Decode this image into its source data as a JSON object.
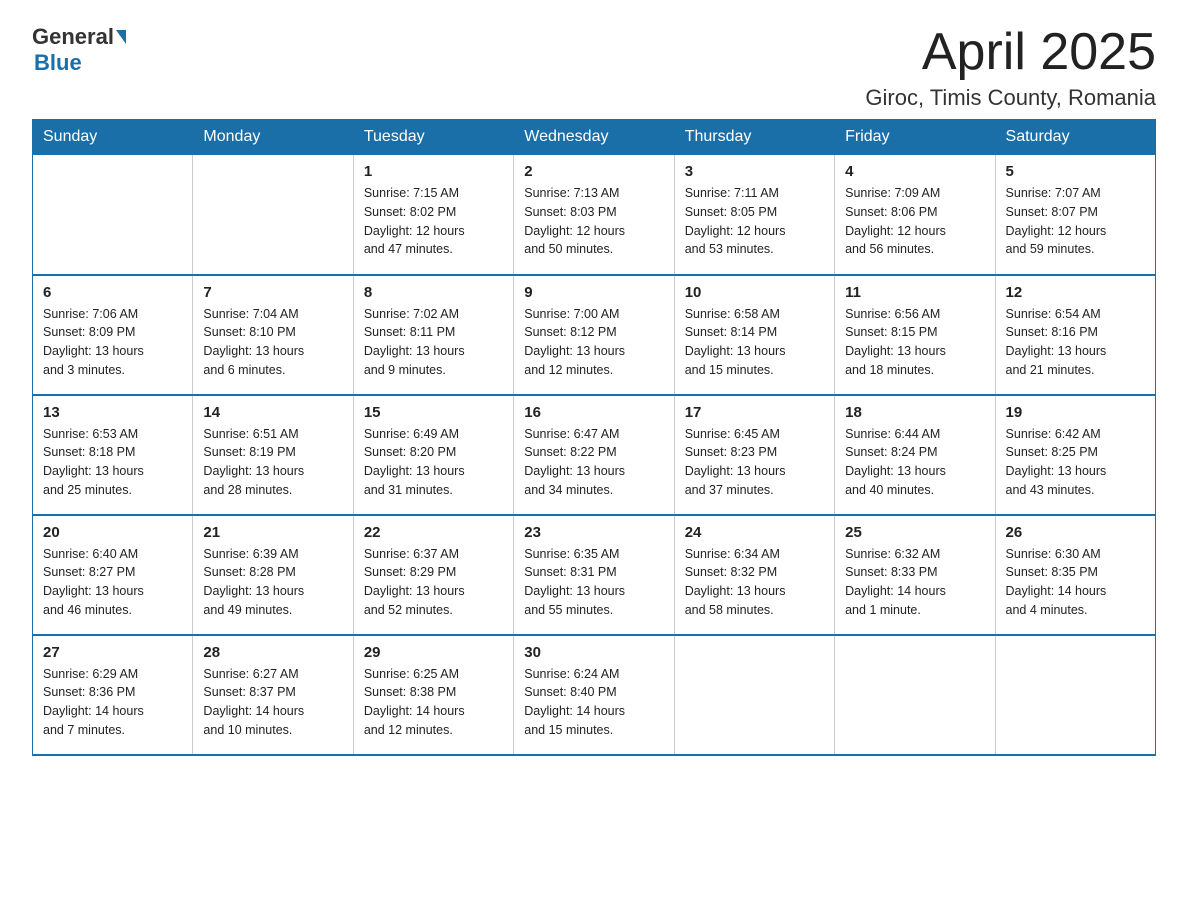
{
  "header": {
    "logo_general": "General",
    "logo_blue": "Blue",
    "month_title": "April 2025",
    "location": "Giroc, Timis County, Romania"
  },
  "columns": [
    "Sunday",
    "Monday",
    "Tuesday",
    "Wednesday",
    "Thursday",
    "Friday",
    "Saturday"
  ],
  "weeks": [
    [
      {
        "day": "",
        "info": ""
      },
      {
        "day": "",
        "info": ""
      },
      {
        "day": "1",
        "info": "Sunrise: 7:15 AM\nSunset: 8:02 PM\nDaylight: 12 hours\nand 47 minutes."
      },
      {
        "day": "2",
        "info": "Sunrise: 7:13 AM\nSunset: 8:03 PM\nDaylight: 12 hours\nand 50 minutes."
      },
      {
        "day": "3",
        "info": "Sunrise: 7:11 AM\nSunset: 8:05 PM\nDaylight: 12 hours\nand 53 minutes."
      },
      {
        "day": "4",
        "info": "Sunrise: 7:09 AM\nSunset: 8:06 PM\nDaylight: 12 hours\nand 56 minutes."
      },
      {
        "day": "5",
        "info": "Sunrise: 7:07 AM\nSunset: 8:07 PM\nDaylight: 12 hours\nand 59 minutes."
      }
    ],
    [
      {
        "day": "6",
        "info": "Sunrise: 7:06 AM\nSunset: 8:09 PM\nDaylight: 13 hours\nand 3 minutes."
      },
      {
        "day": "7",
        "info": "Sunrise: 7:04 AM\nSunset: 8:10 PM\nDaylight: 13 hours\nand 6 minutes."
      },
      {
        "day": "8",
        "info": "Sunrise: 7:02 AM\nSunset: 8:11 PM\nDaylight: 13 hours\nand 9 minutes."
      },
      {
        "day": "9",
        "info": "Sunrise: 7:00 AM\nSunset: 8:12 PM\nDaylight: 13 hours\nand 12 minutes."
      },
      {
        "day": "10",
        "info": "Sunrise: 6:58 AM\nSunset: 8:14 PM\nDaylight: 13 hours\nand 15 minutes."
      },
      {
        "day": "11",
        "info": "Sunrise: 6:56 AM\nSunset: 8:15 PM\nDaylight: 13 hours\nand 18 minutes."
      },
      {
        "day": "12",
        "info": "Sunrise: 6:54 AM\nSunset: 8:16 PM\nDaylight: 13 hours\nand 21 minutes."
      }
    ],
    [
      {
        "day": "13",
        "info": "Sunrise: 6:53 AM\nSunset: 8:18 PM\nDaylight: 13 hours\nand 25 minutes."
      },
      {
        "day": "14",
        "info": "Sunrise: 6:51 AM\nSunset: 8:19 PM\nDaylight: 13 hours\nand 28 minutes."
      },
      {
        "day": "15",
        "info": "Sunrise: 6:49 AM\nSunset: 8:20 PM\nDaylight: 13 hours\nand 31 minutes."
      },
      {
        "day": "16",
        "info": "Sunrise: 6:47 AM\nSunset: 8:22 PM\nDaylight: 13 hours\nand 34 minutes."
      },
      {
        "day": "17",
        "info": "Sunrise: 6:45 AM\nSunset: 8:23 PM\nDaylight: 13 hours\nand 37 minutes."
      },
      {
        "day": "18",
        "info": "Sunrise: 6:44 AM\nSunset: 8:24 PM\nDaylight: 13 hours\nand 40 minutes."
      },
      {
        "day": "19",
        "info": "Sunrise: 6:42 AM\nSunset: 8:25 PM\nDaylight: 13 hours\nand 43 minutes."
      }
    ],
    [
      {
        "day": "20",
        "info": "Sunrise: 6:40 AM\nSunset: 8:27 PM\nDaylight: 13 hours\nand 46 minutes."
      },
      {
        "day": "21",
        "info": "Sunrise: 6:39 AM\nSunset: 8:28 PM\nDaylight: 13 hours\nand 49 minutes."
      },
      {
        "day": "22",
        "info": "Sunrise: 6:37 AM\nSunset: 8:29 PM\nDaylight: 13 hours\nand 52 minutes."
      },
      {
        "day": "23",
        "info": "Sunrise: 6:35 AM\nSunset: 8:31 PM\nDaylight: 13 hours\nand 55 minutes."
      },
      {
        "day": "24",
        "info": "Sunrise: 6:34 AM\nSunset: 8:32 PM\nDaylight: 13 hours\nand 58 minutes."
      },
      {
        "day": "25",
        "info": "Sunrise: 6:32 AM\nSunset: 8:33 PM\nDaylight: 14 hours\nand 1 minute."
      },
      {
        "day": "26",
        "info": "Sunrise: 6:30 AM\nSunset: 8:35 PM\nDaylight: 14 hours\nand 4 minutes."
      }
    ],
    [
      {
        "day": "27",
        "info": "Sunrise: 6:29 AM\nSunset: 8:36 PM\nDaylight: 14 hours\nand 7 minutes."
      },
      {
        "day": "28",
        "info": "Sunrise: 6:27 AM\nSunset: 8:37 PM\nDaylight: 14 hours\nand 10 minutes."
      },
      {
        "day": "29",
        "info": "Sunrise: 6:25 AM\nSunset: 8:38 PM\nDaylight: 14 hours\nand 12 minutes."
      },
      {
        "day": "30",
        "info": "Sunrise: 6:24 AM\nSunset: 8:40 PM\nDaylight: 14 hours\nand 15 minutes."
      },
      {
        "day": "",
        "info": ""
      },
      {
        "day": "",
        "info": ""
      },
      {
        "day": "",
        "info": ""
      }
    ]
  ]
}
